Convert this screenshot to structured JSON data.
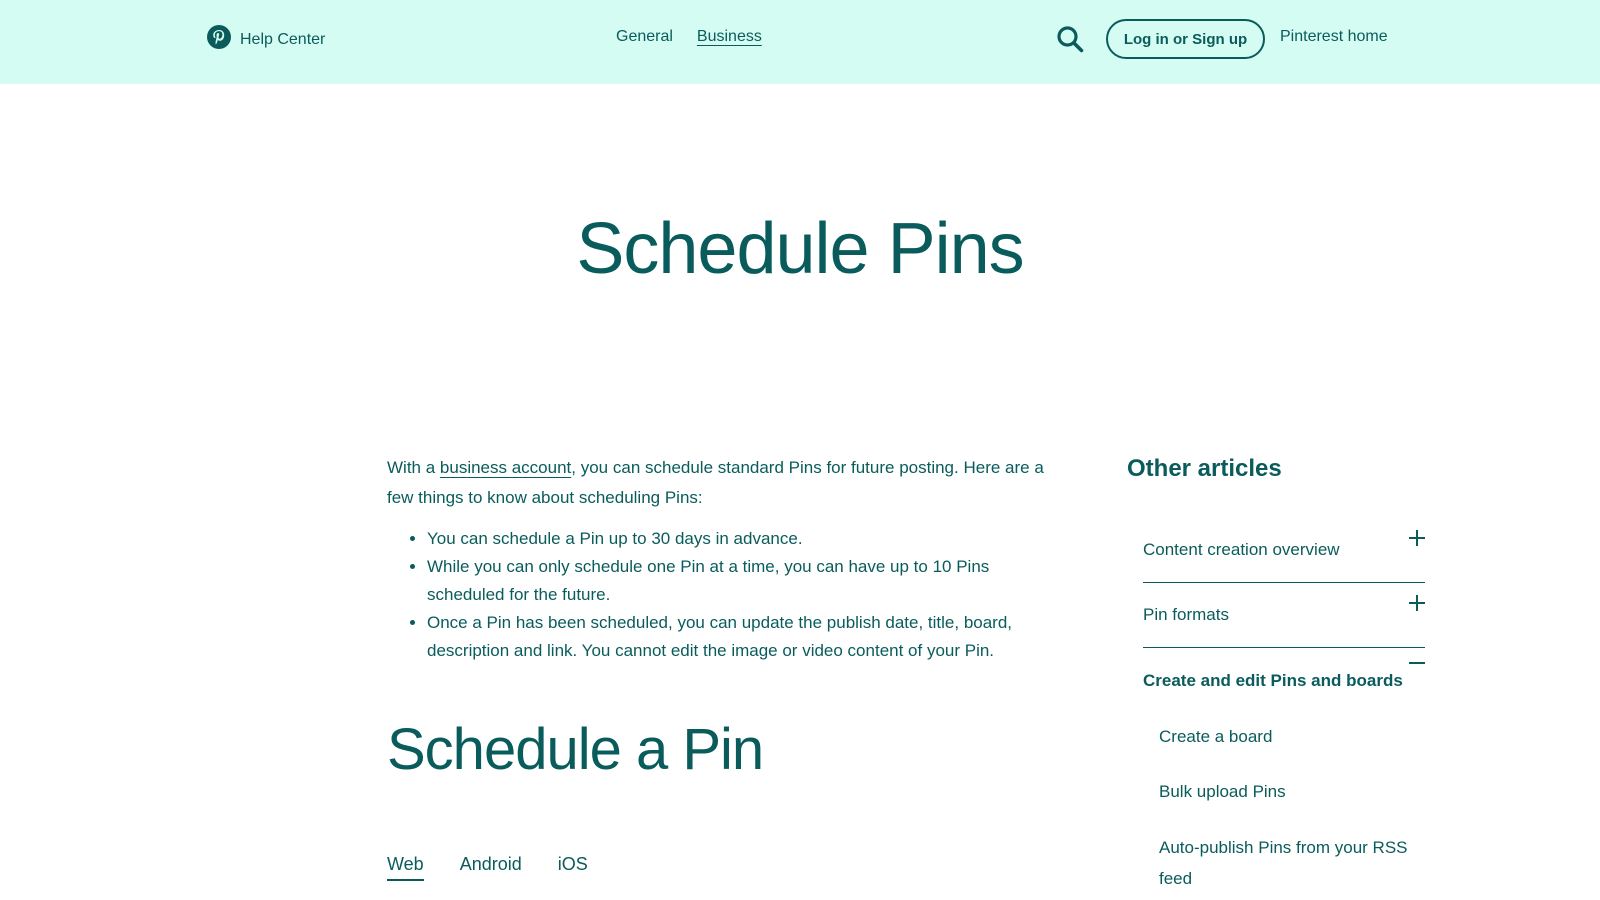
{
  "header": {
    "brand": "Help Center",
    "nav": [
      {
        "label": "General"
      },
      {
        "label": "Business"
      }
    ],
    "login_label": "Log in or Sign up",
    "home_label": "Pinterest home",
    "icons": {
      "logo": "pinterest-logo-icon",
      "search": "search-icon"
    },
    "colors": {
      "header_bg": "#d5fcf3",
      "brand_teal": "#0a5c5c"
    }
  },
  "page": {
    "title": "Schedule Pins",
    "intro_prefix": "With a ",
    "intro_link": "business account",
    "intro_suffix": ", you can schedule standard Pins for future posting. Here are a few things to know about scheduling Pins:",
    "bullets": [
      "You can schedule a Pin up to 30 days in advance.",
      "While you can only schedule one Pin at a time, you can have up to 10 Pins scheduled for the future.",
      "Once a Pin has been scheduled, you can update the publish date, title, board, description and link. You cannot edit the image or video content of your Pin."
    ],
    "section_title": "Schedule a Pin",
    "tabs": [
      "Web",
      "Android",
      "iOS"
    ]
  },
  "sidebar": {
    "title": "Other articles",
    "categories": [
      {
        "label": "Content creation overview",
        "icon": "plus-icon"
      },
      {
        "label": "Pin formats",
        "icon": "plus-icon"
      },
      {
        "label": "Create and edit Pins and boards",
        "icon": "minus-icon"
      }
    ],
    "sub_items": [
      "Create a board",
      "Bulk upload Pins",
      "Auto-publish Pins from your RSS feed"
    ]
  }
}
